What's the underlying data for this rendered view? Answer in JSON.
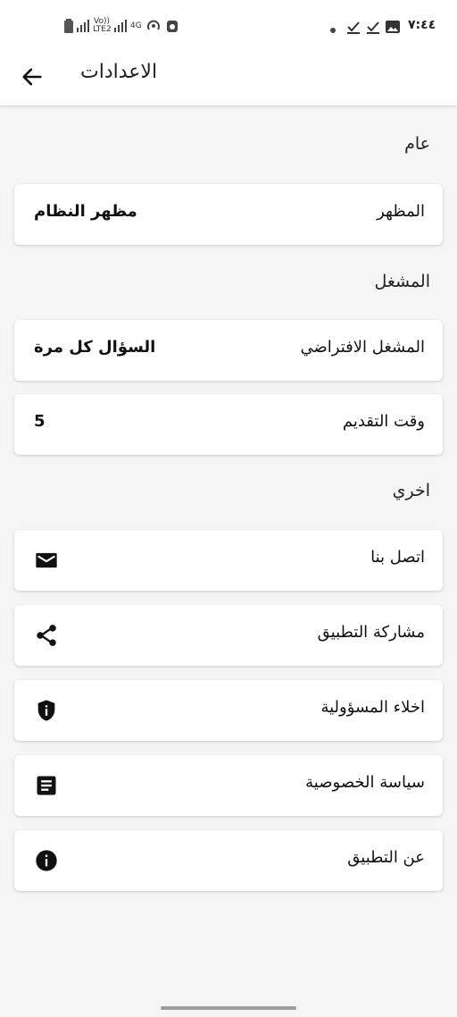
{
  "status_bar": {
    "time": "٧:٤٤",
    "left_labels": {
      "volte": "Vo)) LTE2",
      "network": "4G"
    }
  },
  "app_bar": {
    "title": "الاعدادات",
    "back_icon": "arrow-back-icon"
  },
  "sections": {
    "general": {
      "title": "عام",
      "appearance": {
        "label": "المظهر",
        "value": "مظهر النظام"
      }
    },
    "player": {
      "title": "المشغل",
      "default_player": {
        "label": "المشغل الافتراضي",
        "value": "السؤال كل مرة"
      },
      "seek_time": {
        "label": "وقت التقديم",
        "value": "5"
      }
    },
    "other": {
      "title": "اخري",
      "items": [
        {
          "label": "اتصل بنا",
          "icon": "email-icon"
        },
        {
          "label": "مشاركة التطبيق",
          "icon": "share-icon"
        },
        {
          "label": "اخلاء المسؤولية",
          "icon": "shield-icon"
        },
        {
          "label": "سياسة الخصوصية",
          "icon": "document-icon"
        },
        {
          "label": "عن التطبيق",
          "icon": "info-icon"
        }
      ]
    }
  }
}
